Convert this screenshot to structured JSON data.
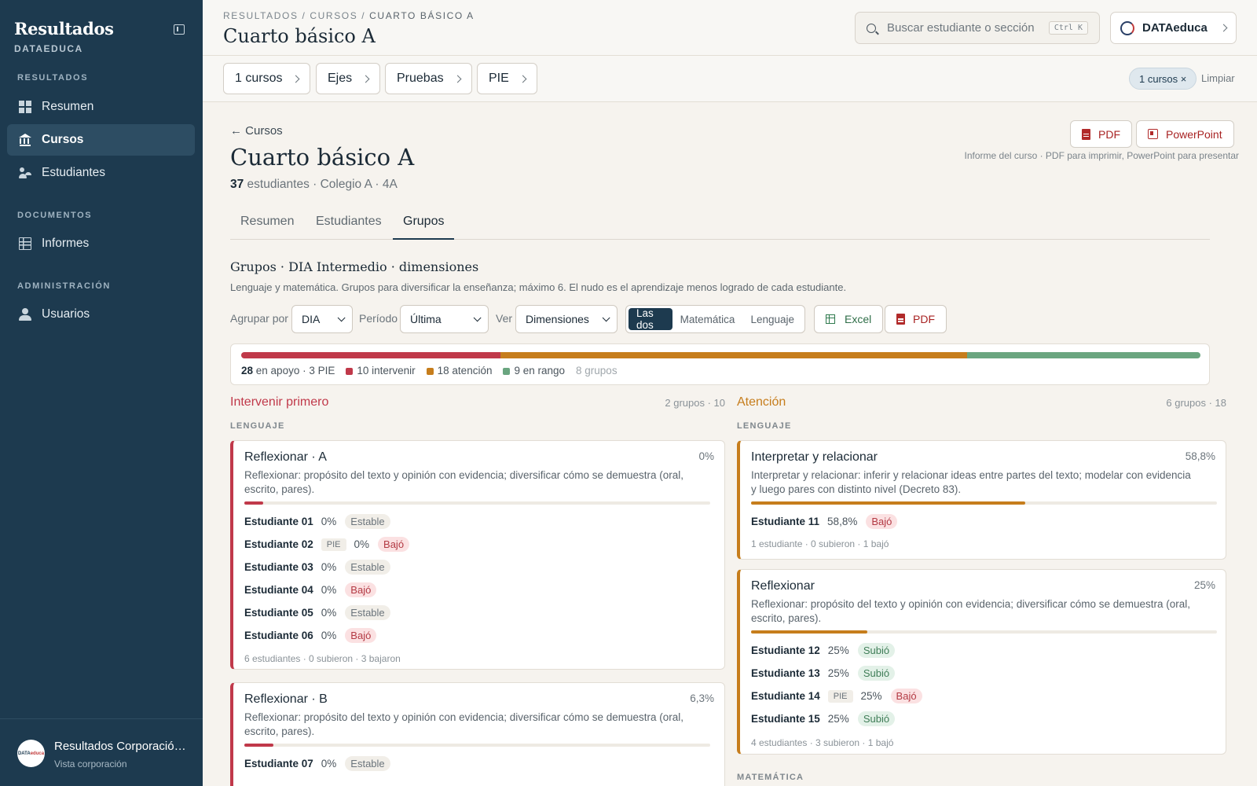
{
  "sidebar": {
    "title": "Resultados",
    "subtitle": "DATAEDUCA",
    "sections": [
      {
        "label": "RESULTADOS"
      },
      {
        "label": "DOCUMENTOS"
      },
      {
        "label": "ADMINISTRACIÓN"
      }
    ],
    "items": [
      {
        "label": "Resumen",
        "icon": "grid-icon"
      },
      {
        "label": "Cursos",
        "icon": "bank-icon",
        "active": true
      },
      {
        "label": "Estudiantes",
        "icon": "people-icon"
      },
      {
        "label": "Informes",
        "icon": "table-icon"
      },
      {
        "label": "Usuarios",
        "icon": "user-icon"
      }
    ],
    "footer": {
      "logo_text_a": "DATA",
      "logo_text_b": "educa",
      "name": "Resultados Corporación Educacional",
      "sub": "Vista corporación"
    }
  },
  "topbar": {
    "breadcrumb": [
      "RESULTADOS",
      "CURSOS",
      "CUARTO BÁSICO A"
    ],
    "sep": "/",
    "title": "Cuarto básico A",
    "search_placeholder": "Buscar estudiante o sección",
    "search_shortcut": "Ctrl K",
    "org": "DATAeduca"
  },
  "filters": {
    "chips": [
      "1 cursos",
      "Ejes",
      "Pruebas",
      "PIE"
    ],
    "active": "1 cursos ×",
    "clear": "Limpiar"
  },
  "course": {
    "back": "← Cursos",
    "title": "Cuarto básico A",
    "students": "37",
    "meta": " estudiantes · Colegio A · 4A",
    "export_pdf": "PDF",
    "export_ppt": "PowerPoint",
    "export_note": "Informe del curso · PDF para imprimir, PowerPoint para presentar"
  },
  "tabs": [
    "Resumen",
    "Estudiantes",
    "Grupos"
  ],
  "groups_section": {
    "title": "Grupos · DIA Intermedio · dimensiones",
    "desc": "Lenguaje y matemática. Grupos para diversificar la enseñanza; máximo 6. El nudo es el aprendizaje menos logrado de cada estudiante.",
    "group_by_label": "Agrupar por",
    "group_by_value": "DIA",
    "period_label": "Período",
    "period_value": "Última",
    "view_label": "Ver",
    "view_value": "Dimensiones",
    "segments": [
      "Las dos",
      "Matemática",
      "Lenguaje"
    ],
    "excel": "Excel",
    "pdf": "PDF"
  },
  "colors": {
    "intervenir": "#c0394a",
    "atencion": "#c67d1c",
    "rango": "#6aa57f",
    "navy": "#1d3a4f"
  },
  "summary": {
    "apoyo_n": "28",
    "apoyo_text": " en apoyo · 3 PIE",
    "intervenir_n": 10,
    "intervenir": "10 intervenir",
    "atencion_n": 18,
    "atencion": "18 atención",
    "rango_n": 9,
    "rango": "9 en rango",
    "grupos": "8 grupos"
  },
  "columns": {
    "left": {
      "title": "Intervenir primero",
      "count": "2 grupos · 10",
      "axis": "LENGUAJE",
      "cards": [
        {
          "title": "Reflexionar · A",
          "pct": "0%",
          "fill": 4,
          "desc": "Reflexionar: propósito del texto y opinión con evidencia; diversificar cómo se demuestra (oral, escrito, pares).",
          "students": [
            {
              "name": "Estudiante 01",
              "pie": "",
              "pct": "0%",
              "badge": "Estable",
              "type": "estable"
            },
            {
              "name": "Estudiante 02",
              "pie": "PIE",
              "pct": "0%",
              "badge": "Bajó",
              "type": "bajo"
            },
            {
              "name": "Estudiante 03",
              "pie": "",
              "pct": "0%",
              "badge": "Estable",
              "type": "estable"
            },
            {
              "name": "Estudiante 04",
              "pie": "",
              "pct": "0%",
              "badge": "Bajó",
              "type": "bajo"
            },
            {
              "name": "Estudiante 05",
              "pie": "",
              "pct": "0%",
              "badge": "Estable",
              "type": "estable"
            },
            {
              "name": "Estudiante 06",
              "pie": "",
              "pct": "0%",
              "badge": "Bajó",
              "type": "bajo"
            }
          ],
          "foot": "6 estudiantes · 0 subieron · 3 bajaron"
        },
        {
          "title": "Reflexionar · B",
          "pct": "6,3%",
          "fill": 6.3,
          "desc": "Reflexionar: propósito del texto y opinión con evidencia; diversificar cómo se demuestra (oral, escrito, pares).",
          "students": [
            {
              "name": "Estudiante 07",
              "pie": "",
              "pct": "0%",
              "badge": "Estable",
              "type": "estable"
            }
          ],
          "foot": ""
        }
      ]
    },
    "right": {
      "title": "Atención",
      "count": "6 grupos · 18",
      "axis": "LENGUAJE",
      "axis2": "MATEMÁTICA",
      "cards": [
        {
          "title": "Interpretar y relacionar",
          "pct": "58,8%",
          "fill": 58.8,
          "desc": "Interpretar y relacionar: inferir y relacionar ideas entre partes del texto; modelar con evidencia y luego pares con distinto nivel (Decreto 83).",
          "students": [
            {
              "name": "Estudiante 11",
              "pie": "",
              "pct": "58,8%",
              "badge": "Bajó",
              "type": "bajo"
            }
          ],
          "foot": "1 estudiante · 0 subieron · 1 bajó"
        },
        {
          "title": "Reflexionar",
          "pct": "25%",
          "fill": 25,
          "desc": "Reflexionar: propósito del texto y opinión con evidencia; diversificar cómo se demuestra (oral, escrito, pares).",
          "students": [
            {
              "name": "Estudiante 12",
              "pie": "",
              "pct": "25%",
              "badge": "Subió",
              "type": "subio"
            },
            {
              "name": "Estudiante 13",
              "pie": "",
              "pct": "25%",
              "badge": "Subió",
              "type": "subio"
            },
            {
              "name": "Estudiante 14",
              "pie": "PIE",
              "pct": "25%",
              "badge": "Bajó",
              "type": "bajo"
            },
            {
              "name": "Estudiante 15",
              "pie": "",
              "pct": "25%",
              "badge": "Subió",
              "type": "subio"
            }
          ],
          "foot": "4 estudiantes · 3 subieron · 1 bajó"
        }
      ]
    }
  }
}
